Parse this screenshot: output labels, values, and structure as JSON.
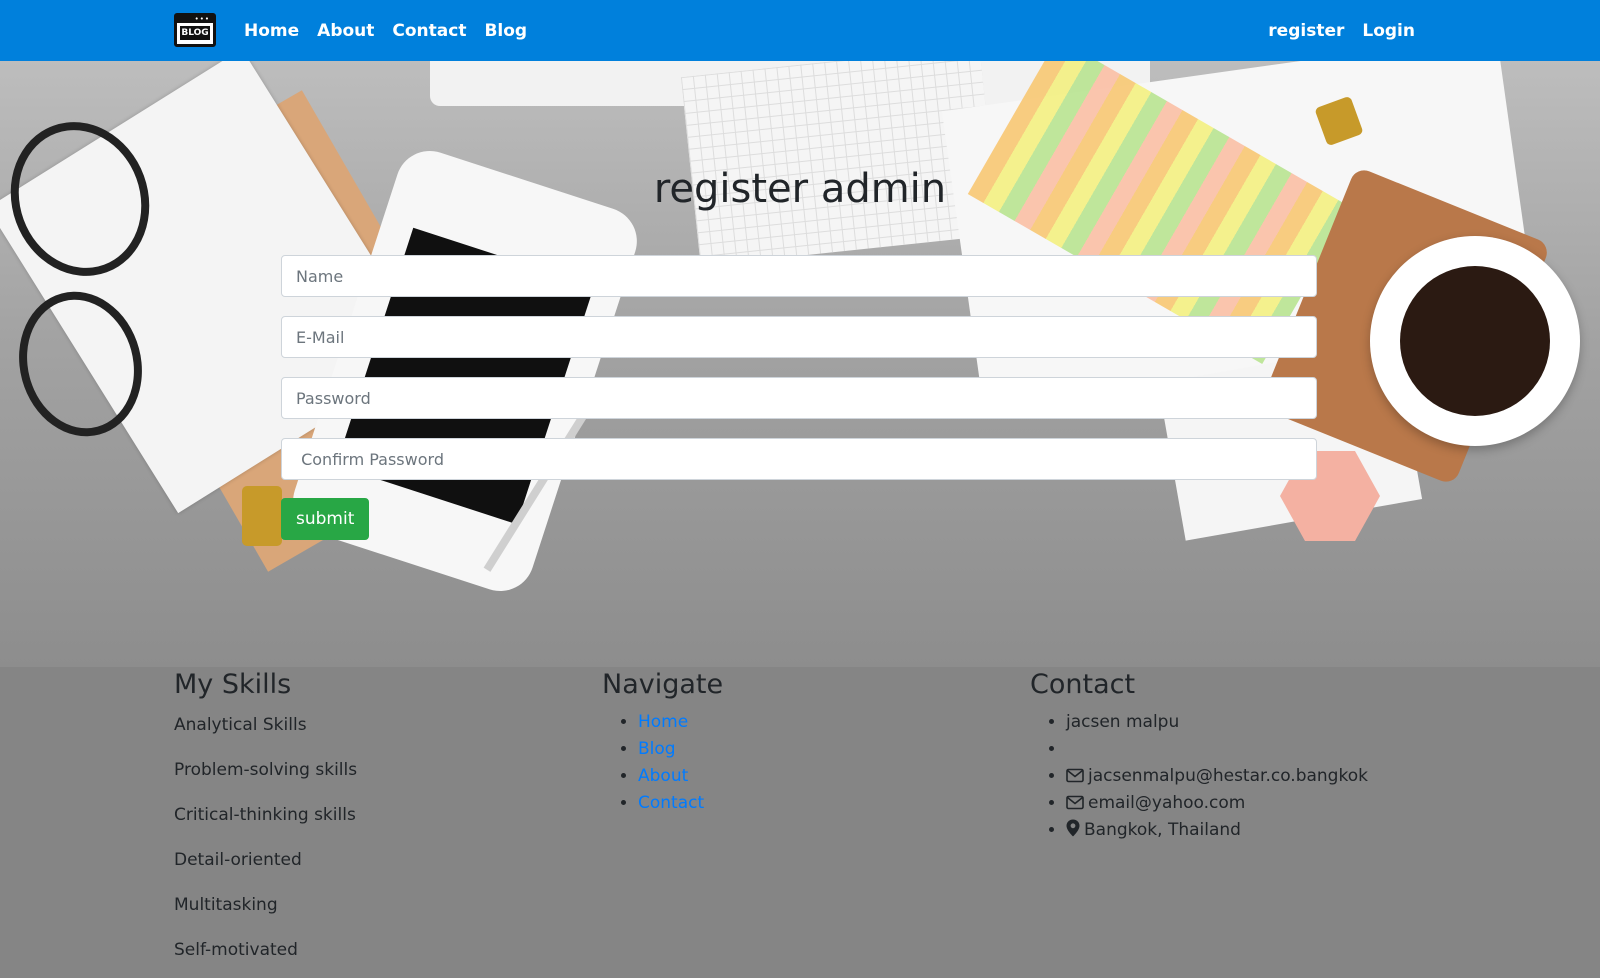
{
  "navbar": {
    "brand_text": "BLOG",
    "links": [
      "Home",
      "About",
      "Contact",
      "Blog"
    ],
    "right_links": [
      "register",
      "Login"
    ],
    "color": "#0080dc"
  },
  "form": {
    "title": "register admin",
    "name_placeholder": "Name",
    "email_placeholder": "E-Mail",
    "password_placeholder": "Password",
    "confirm_placeholder": " Confirm Password",
    "submit_label": "submit",
    "submit_color": "#28a745"
  },
  "footer": {
    "skills": {
      "heading": "My Skills",
      "items": [
        "Analytical Skills",
        "Problem-solving skills",
        "Critical-thinking skills",
        "Detail-oriented",
        "Multitasking",
        "Self-motivated"
      ]
    },
    "navigate": {
      "heading": "Navigate",
      "links": [
        "Home",
        "Blog",
        "About",
        "Contact"
      ]
    },
    "contact": {
      "heading": "Contact",
      "name": "jacsen malpu",
      "empty_item": "",
      "email1": "jacsenmalpu@hestar.co.bangkok",
      "email2": "email@yahoo.com",
      "location": "Bangkok, Thailand",
      "icons": [
        "envelope-icon",
        "envelope-icon",
        "map-marker-icon"
      ]
    }
  }
}
